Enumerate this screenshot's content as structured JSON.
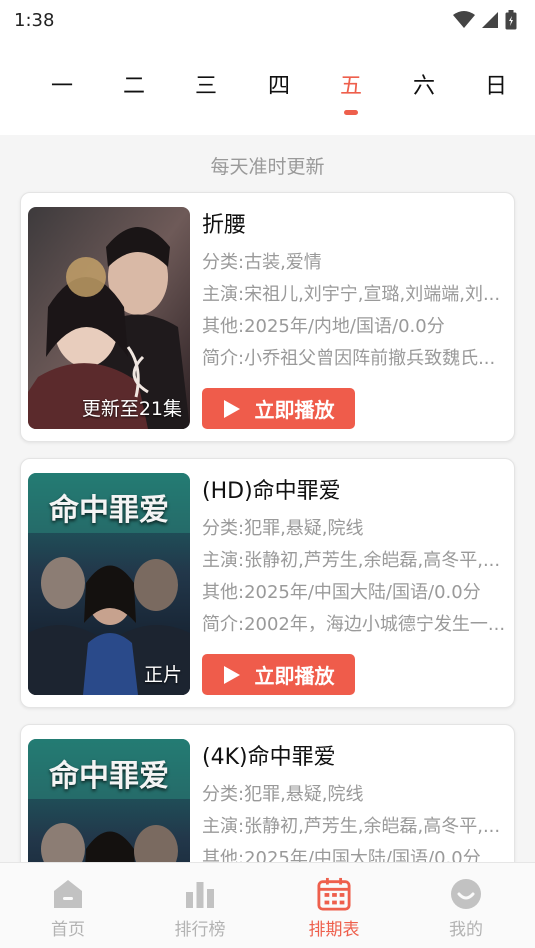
{
  "status_bar": {
    "time": "1:38"
  },
  "days": [
    {
      "label": "一",
      "active": false
    },
    {
      "label": "二",
      "active": false
    },
    {
      "label": "三",
      "active": false
    },
    {
      "label": "四",
      "active": false
    },
    {
      "label": "五",
      "active": true
    },
    {
      "label": "六",
      "active": false
    },
    {
      "label": "日",
      "active": false
    }
  ],
  "subtitle": "每天准时更新",
  "shows": [
    {
      "title": "折腰",
      "category": "分类:古装,爱情",
      "cast": "主演:宋祖儿,刘宇宁,宣璐,刘端端,刘...",
      "other": "其他:2025年/内地/国语/0.0分",
      "summary": "简介:小乔祖父曾因阵前撤兵致魏氏...",
      "poster_tag": "更新至21集",
      "play_label": "立即播放"
    },
    {
      "title": "(HD)命中罪爱",
      "category": "分类:犯罪,悬疑,院线",
      "cast": "主演:张静初,芦芳生,余皑磊,高冬平,...",
      "other": "其他:2025年/中国大陆/国语/0.0分",
      "summary": "简介:2002年，海边小城德宁发生一...",
      "poster_tag": "正片",
      "poster_title": "命中罪爱",
      "play_label": "立即播放"
    },
    {
      "title": "(4K)命中罪爱",
      "category": "分类:犯罪,悬疑,院线",
      "cast": "主演:张静初,芦芳生,余皑磊,高冬平,...",
      "other": "其他:2025年/中国大陆/国语/0.0分",
      "poster_title": "命中罪爱"
    }
  ],
  "tabs": [
    {
      "label": "首页",
      "icon": "home-icon",
      "active": false
    },
    {
      "label": "排行榜",
      "icon": "bar-chart-icon",
      "active": false
    },
    {
      "label": "排期表",
      "icon": "calendar-icon",
      "active": true
    },
    {
      "label": "我的",
      "icon": "smiley-icon",
      "active": false
    }
  ],
  "colors": {
    "accent": "#ee5f4c",
    "muted": "#9a9a9a"
  }
}
